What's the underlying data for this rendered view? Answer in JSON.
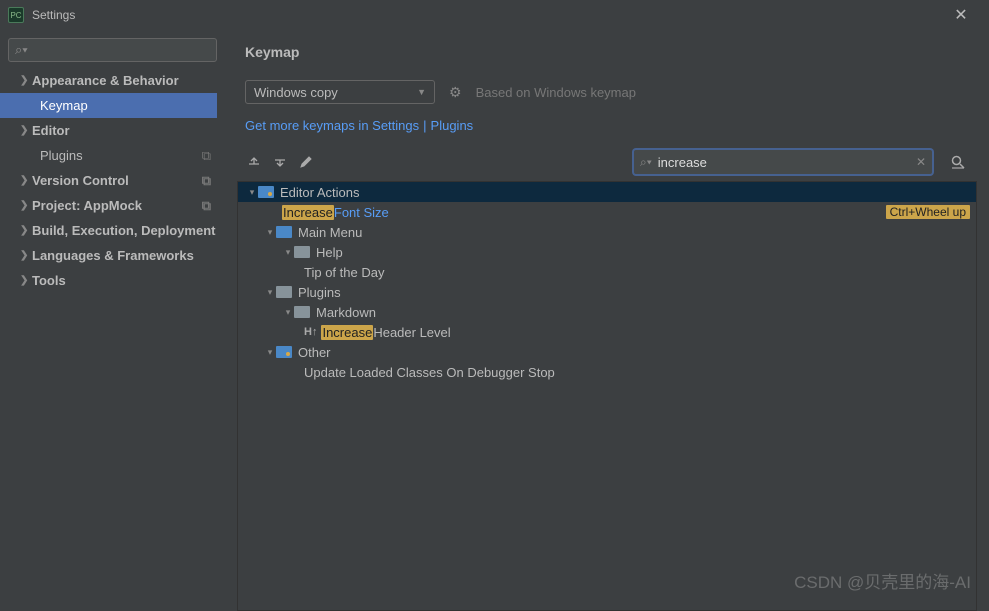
{
  "window": {
    "title": "Settings",
    "close": "✕"
  },
  "sidebar": {
    "search_placeholder": " ",
    "items": [
      {
        "label": "Appearance & Behavior",
        "expandable": true,
        "bold": true
      },
      {
        "label": "Keymap",
        "indent": true,
        "selected": true
      },
      {
        "label": "Editor",
        "expandable": true,
        "bold": true
      },
      {
        "label": "Plugins",
        "indent": true,
        "tag": "⧉"
      },
      {
        "label": "Version Control",
        "expandable": true,
        "bold": true,
        "tag": "⧉"
      },
      {
        "label": "Project: AppMock",
        "expandable": true,
        "bold": true,
        "tag": "⧉"
      },
      {
        "label": "Build, Execution, Deployment",
        "expandable": true,
        "bold": true
      },
      {
        "label": "Languages & Frameworks",
        "expandable": true,
        "bold": true
      },
      {
        "label": "Tools",
        "expandable": true,
        "bold": true
      }
    ]
  },
  "main": {
    "heading": "Keymap",
    "scheme": "Windows copy",
    "based_on": "Based on Windows keymap",
    "link1": "Get more keymaps in Settings",
    "link2": "Plugins",
    "search_value": "increase",
    "tree": {
      "editor_actions": "Editor Actions",
      "increase_font_pre": "Increase",
      "increase_font_post": " Font Size",
      "increase_font_sc": "Ctrl+Wheel up",
      "main_menu": "Main Menu",
      "help": "Help",
      "tip": "Tip of the Day",
      "plugins": "Plugins",
      "markdown": "Markdown",
      "h_icon": "H↑",
      "increase_header_pre": "Increase",
      "increase_header_post": " Header Level",
      "other": "Other",
      "update_classes": "Update Loaded Classes On Debugger Stop"
    }
  },
  "watermark": "CSDN @贝壳里的海-AI"
}
